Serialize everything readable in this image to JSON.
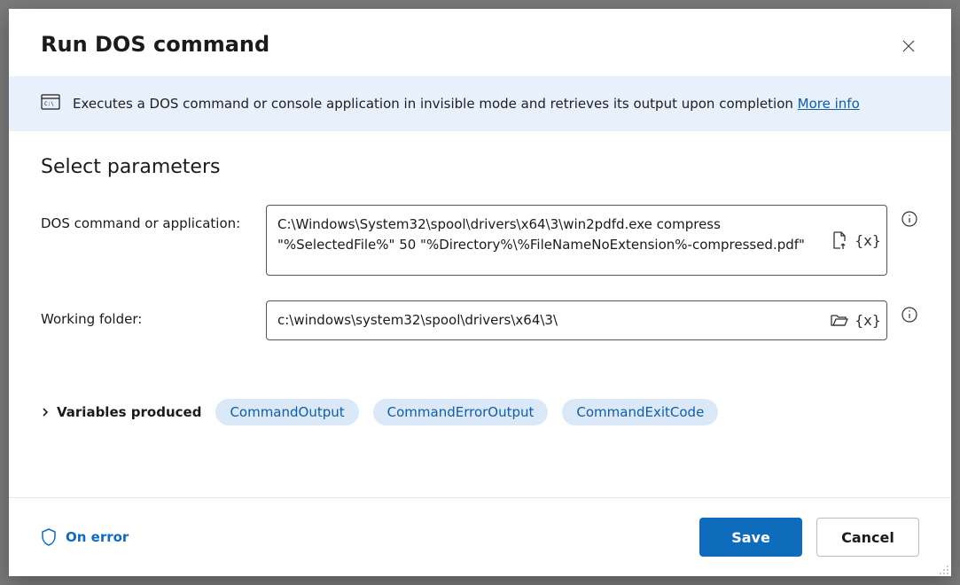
{
  "dialog": {
    "title": "Run DOS command",
    "info_banner": "Executes a DOS command or console application in invisible mode and retrieves its output upon completion",
    "more_info": "More info",
    "section_title": "Select parameters"
  },
  "params": {
    "command_label": "DOS command or application:",
    "command_value": "C:\\Windows\\System32\\spool\\drivers\\x64\\3\\win2pdfd.exe compress \"%SelectedFile%\" 50 \"%Directory%\\%FileNameNoExtension%-compressed.pdf\"",
    "folder_label": "Working folder:",
    "folder_value": "c:\\windows\\system32\\spool\\drivers\\x64\\3\\"
  },
  "variables": {
    "label": "Variables produced",
    "chips": [
      "CommandOutput",
      "CommandErrorOutput",
      "CommandExitCode"
    ]
  },
  "footer": {
    "on_error": "On error",
    "save": "Save",
    "cancel": "Cancel"
  }
}
